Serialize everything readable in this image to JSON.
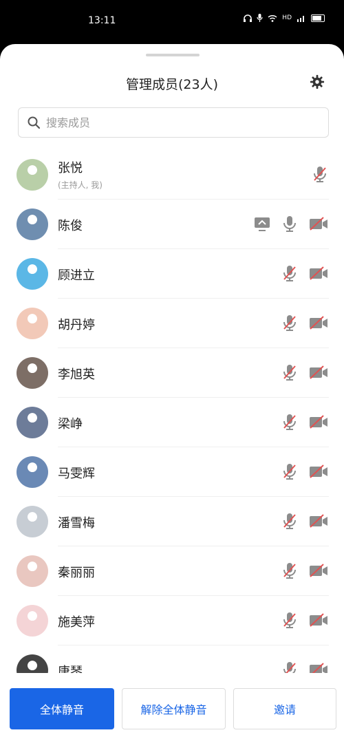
{
  "status_bar": {
    "time": "13:11",
    "icons": [
      "headphones-icon",
      "mic-icon",
      "wifi-icon",
      "hd-icon",
      "signal-icon",
      "battery-icon"
    ],
    "hd_label": "HD"
  },
  "header": {
    "title": "管理成员(23人)",
    "settings_icon": "gear-icon"
  },
  "search": {
    "placeholder": "搜索成员"
  },
  "members": [
    {
      "name": "张悦",
      "sub": "(主持人, 我)",
      "screen_share": false,
      "mic_muted": true,
      "video_off": null,
      "avatar_color": "#b9cfa8"
    },
    {
      "name": "陈俊",
      "sub": "",
      "screen_share": true,
      "mic_muted": false,
      "video_off": true,
      "avatar_color": "#6f8eb0"
    },
    {
      "name": "顾进立",
      "sub": "",
      "screen_share": false,
      "mic_muted": true,
      "video_off": true,
      "avatar_color": "#5bb7e6"
    },
    {
      "name": "胡丹婷",
      "sub": "",
      "screen_share": false,
      "mic_muted": true,
      "video_off": true,
      "avatar_color": "#f2c9b8"
    },
    {
      "name": "李旭英",
      "sub": "",
      "screen_share": false,
      "mic_muted": true,
      "video_off": true,
      "avatar_color": "#7d6e66"
    },
    {
      "name": "梁峥",
      "sub": "",
      "screen_share": false,
      "mic_muted": true,
      "video_off": true,
      "avatar_color": "#6d7c99"
    },
    {
      "name": "马雯辉",
      "sub": "",
      "screen_share": false,
      "mic_muted": true,
      "video_off": true,
      "avatar_color": "#6a89b5"
    },
    {
      "name": "潘雪梅",
      "sub": "",
      "screen_share": false,
      "mic_muted": true,
      "video_off": true,
      "avatar_color": "#c7cdd4"
    },
    {
      "name": "秦丽丽",
      "sub": "",
      "screen_share": false,
      "mic_muted": true,
      "video_off": true,
      "avatar_color": "#e9c7c0"
    },
    {
      "name": "施美萍",
      "sub": "",
      "screen_share": false,
      "mic_muted": true,
      "video_off": true,
      "avatar_color": "#f4d4d6"
    },
    {
      "name": "唐琴",
      "sub": "",
      "screen_share": false,
      "mic_muted": true,
      "video_off": true,
      "avatar_color": "#444"
    }
  ],
  "actions": {
    "mute_all": "全体静音",
    "unmute_all": "解除全体静音",
    "invite": "邀请"
  },
  "colors": {
    "accent": "#1a66e6",
    "muted_red": "#e05252",
    "icon_gray": "#8c8c8c"
  }
}
